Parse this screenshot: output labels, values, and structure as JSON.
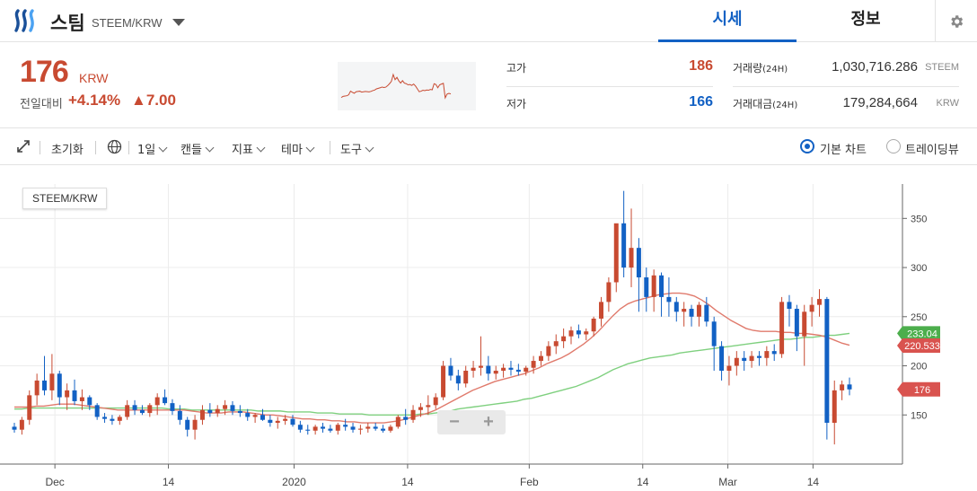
{
  "header": {
    "coin_name": "스팀",
    "pair": "STEEM/KRW",
    "tabs": [
      {
        "label": "시세",
        "active": true
      },
      {
        "label": "정보",
        "active": false
      }
    ]
  },
  "summary": {
    "price": "176",
    "price_unit": "KRW",
    "change_label": "전일대비",
    "change_rate": "+4.14%",
    "change_abs": "▲7.00",
    "high_label": "고가",
    "high": "186",
    "low_label": "저가",
    "low": "166",
    "volume_label": "거래량",
    "volume_period": "(24H)",
    "volume": "1,030,716.286",
    "volume_unit": "STEEM",
    "amount_label": "거래대금",
    "amount_period": "(24H)",
    "amount": "179,284,664",
    "amount_unit": "KRW"
  },
  "toolbar": {
    "reset": "초기화",
    "interval": "1일",
    "candle": "캔들",
    "indicator": "지표",
    "theme": "테마",
    "tools": "도구",
    "basic_chart": "기본 차트",
    "tradingview": "트레이딩뷰"
  },
  "colors": {
    "up": "#c84a31",
    "down": "#1261c4",
    "ma_red": "#e07a6c",
    "ma_green": "#7fd07f",
    "accent": "#1261c4"
  },
  "chart_data": {
    "type": "candlestick",
    "pair_label": "STEEM/KRW",
    "x_ticks": [
      "Dec",
      "14",
      "2020",
      "14",
      "Feb",
      "14",
      "Mar",
      "14"
    ],
    "y_ticks": [
      150,
      200,
      250,
      300,
      350
    ],
    "ylim": [
      100,
      385
    ],
    "price_tags": [
      {
        "value": 233.04,
        "label": "233.04",
        "color": "#4cae4c"
      },
      {
        "value": 220.533,
        "label": "220.533",
        "color": "#d9534f"
      },
      {
        "value": 176,
        "label": "176",
        "color": "#d9534f"
      }
    ],
    "ohlc": [
      [
        138,
        142,
        132,
        135
      ],
      [
        135,
        148,
        130,
        145
      ],
      [
        145,
        175,
        140,
        170
      ],
      [
        170,
        192,
        160,
        185
      ],
      [
        185,
        210,
        170,
        175
      ],
      [
        175,
        212,
        165,
        192
      ],
      [
        192,
        195,
        160,
        168
      ],
      [
        168,
        182,
        155,
        175
      ],
      [
        175,
        186,
        160,
        164
      ],
      [
        164,
        176,
        155,
        168
      ],
      [
        168,
        170,
        155,
        160
      ],
      [
        160,
        162,
        145,
        148
      ],
      [
        148,
        152,
        142,
        146
      ],
      [
        146,
        150,
        140,
        144
      ],
      [
        144,
        150,
        140,
        148
      ],
      [
        148,
        165,
        145,
        160
      ],
      [
        160,
        165,
        150,
        155
      ],
      [
        155,
        160,
        150,
        152
      ],
      [
        152,
        162,
        148,
        160
      ],
      [
        160,
        172,
        150,
        168
      ],
      [
        168,
        176,
        160,
        162
      ],
      [
        162,
        166,
        150,
        154
      ],
      [
        154,
        160,
        140,
        145
      ],
      [
        145,
        148,
        128,
        135
      ],
      [
        135,
        150,
        125,
        145
      ],
      [
        145,
        160,
        140,
        155
      ],
      [
        155,
        162,
        148,
        152
      ],
      [
        152,
        160,
        148,
        156
      ],
      [
        156,
        165,
        150,
        160
      ],
      [
        160,
        164,
        150,
        154
      ],
      [
        154,
        160,
        148,
        152
      ],
      [
        152,
        156,
        144,
        148
      ],
      [
        148,
        152,
        142,
        150
      ],
      [
        150,
        156,
        144,
        145
      ],
      [
        145,
        150,
        138,
        142
      ],
      [
        142,
        148,
        136,
        144
      ],
      [
        144,
        150,
        140,
        146
      ],
      [
        146,
        150,
        138,
        140
      ],
      [
        140,
        144,
        132,
        135
      ],
      [
        135,
        140,
        130,
        134
      ],
      [
        134,
        140,
        130,
        138
      ],
      [
        138,
        142,
        132,
        136
      ],
      [
        136,
        140,
        132,
        134
      ],
      [
        134,
        142,
        130,
        140
      ],
      [
        140,
        146,
        134,
        138
      ],
      [
        138,
        142,
        132,
        135
      ],
      [
        135,
        140,
        130,
        136
      ],
      [
        136,
        142,
        132,
        138
      ],
      [
        138,
        142,
        134,
        136
      ],
      [
        136,
        140,
        132,
        134
      ],
      [
        134,
        140,
        132,
        138
      ],
      [
        138,
        150,
        136,
        148
      ],
      [
        148,
        156,
        140,
        145
      ],
      [
        145,
        160,
        142,
        155
      ],
      [
        155,
        162,
        148,
        158
      ],
      [
        158,
        170,
        150,
        160
      ],
      [
        160,
        172,
        156,
        168
      ],
      [
        168,
        205,
        165,
        200
      ],
      [
        200,
        208,
        185,
        190
      ],
      [
        190,
        196,
        175,
        182
      ],
      [
        182,
        200,
        178,
        195
      ],
      [
        195,
        205,
        188,
        198
      ],
      [
        198,
        230,
        190,
        200
      ],
      [
        200,
        210,
        185,
        192
      ],
      [
        192,
        200,
        186,
        195
      ],
      [
        195,
        202,
        188,
        198
      ],
      [
        198,
        205,
        190,
        196
      ],
      [
        196,
        202,
        190,
        194
      ],
      [
        194,
        200,
        190,
        198
      ],
      [
        198,
        210,
        192,
        205
      ],
      [
        205,
        215,
        200,
        210
      ],
      [
        210,
        225,
        205,
        220
      ],
      [
        220,
        232,
        212,
        225
      ],
      [
        225,
        238,
        218,
        230
      ],
      [
        230,
        240,
        222,
        236
      ],
      [
        236,
        242,
        228,
        232
      ],
      [
        232,
        238,
        226,
        235
      ],
      [
        235,
        250,
        230,
        248
      ],
      [
        248,
        270,
        240,
        265
      ],
      [
        265,
        290,
        255,
        285
      ],
      [
        285,
        320,
        275,
        345
      ],
      [
        345,
        378,
        290,
        300
      ],
      [
        300,
        360,
        280,
        320
      ],
      [
        320,
        330,
        255,
        290
      ],
      [
        290,
        300,
        255,
        270
      ],
      [
        270,
        298,
        255,
        292
      ],
      [
        292,
        295,
        250,
        270
      ],
      [
        270,
        290,
        250,
        265
      ],
      [
        265,
        270,
        245,
        255
      ],
      [
        255,
        265,
        240,
        258
      ],
      [
        258,
        262,
        240,
        250
      ],
      [
        250,
        265,
        240,
        262
      ],
      [
        262,
        270,
        240,
        245
      ],
      [
        245,
        250,
        195,
        220
      ],
      [
        220,
        225,
        185,
        195
      ],
      [
        195,
        210,
        180,
        200
      ],
      [
        200,
        215,
        190,
        208
      ],
      [
        208,
        215,
        195,
        205
      ],
      [
        205,
        215,
        198,
        210
      ],
      [
        210,
        215,
        200,
        208
      ],
      [
        208,
        220,
        200,
        215
      ],
      [
        215,
        222,
        205,
        212
      ],
      [
        212,
        270,
        208,
        265
      ],
      [
        265,
        272,
        240,
        258
      ],
      [
        258,
        262,
        215,
        230
      ],
      [
        230,
        262,
        200,
        255
      ],
      [
        255,
        270,
        240,
        262
      ],
      [
        262,
        278,
        250,
        268
      ],
      [
        268,
        270,
        125,
        142
      ],
      [
        142,
        185,
        120,
        175
      ],
      [
        175,
        185,
        165,
        181
      ],
      [
        181,
        188,
        170,
        176
      ]
    ],
    "ma_long": [
      156,
      156,
      157,
      157,
      157,
      157,
      157,
      157,
      157,
      157,
      157,
      157,
      157,
      157,
      157,
      157,
      157,
      157,
      157,
      157,
      157,
      156,
      156,
      156,
      155,
      155,
      155,
      155,
      155,
      155,
      155,
      155,
      155,
      154,
      154,
      154,
      154,
      153,
      153,
      153,
      153,
      152,
      152,
      152,
      151,
      151,
      151,
      151,
      150,
      150,
      150,
      150,
      150,
      150,
      150,
      151,
      151,
      152,
      153,
      154,
      156,
      157,
      158,
      159,
      160,
      161,
      162,
      163,
      164,
      166,
      167,
      169,
      171,
      173,
      175,
      177,
      179,
      182,
      185,
      188,
      192,
      196,
      199,
      202,
      204,
      206,
      208,
      209,
      210,
      211,
      213,
      214,
      215,
      216,
      217,
      218,
      219,
      220,
      221,
      222,
      223,
      224,
      225,
      226,
      227,
      227,
      228,
      229,
      229,
      230,
      231,
      231,
      232,
      233
    ],
    "ma_short": [
      158,
      158,
      158,
      159,
      159,
      160,
      161,
      161,
      161,
      160,
      159,
      158,
      157,
      156,
      155,
      155,
      155,
      155,
      155,
      155,
      155,
      155,
      155,
      155,
      154,
      153,
      152,
      152,
      152,
      153,
      153,
      153,
      152,
      151,
      150,
      150,
      149,
      148,
      147,
      146,
      146,
      145,
      145,
      144,
      144,
      143,
      143,
      142,
      142,
      142,
      142,
      143,
      144,
      146,
      148,
      150,
      152,
      155,
      159,
      163,
      167,
      171,
      175,
      178,
      181,
      184,
      186,
      188,
      190,
      192,
      195,
      198,
      202,
      205,
      208,
      212,
      217,
      222,
      228,
      235,
      243,
      251,
      258,
      263,
      266,
      268,
      270,
      272,
      273,
      274,
      274,
      273,
      271,
      267,
      262,
      256,
      251,
      246,
      242,
      238,
      236,
      235,
      235,
      235,
      234,
      234,
      233,
      233,
      232,
      231,
      229,
      226,
      223,
      221
    ]
  }
}
